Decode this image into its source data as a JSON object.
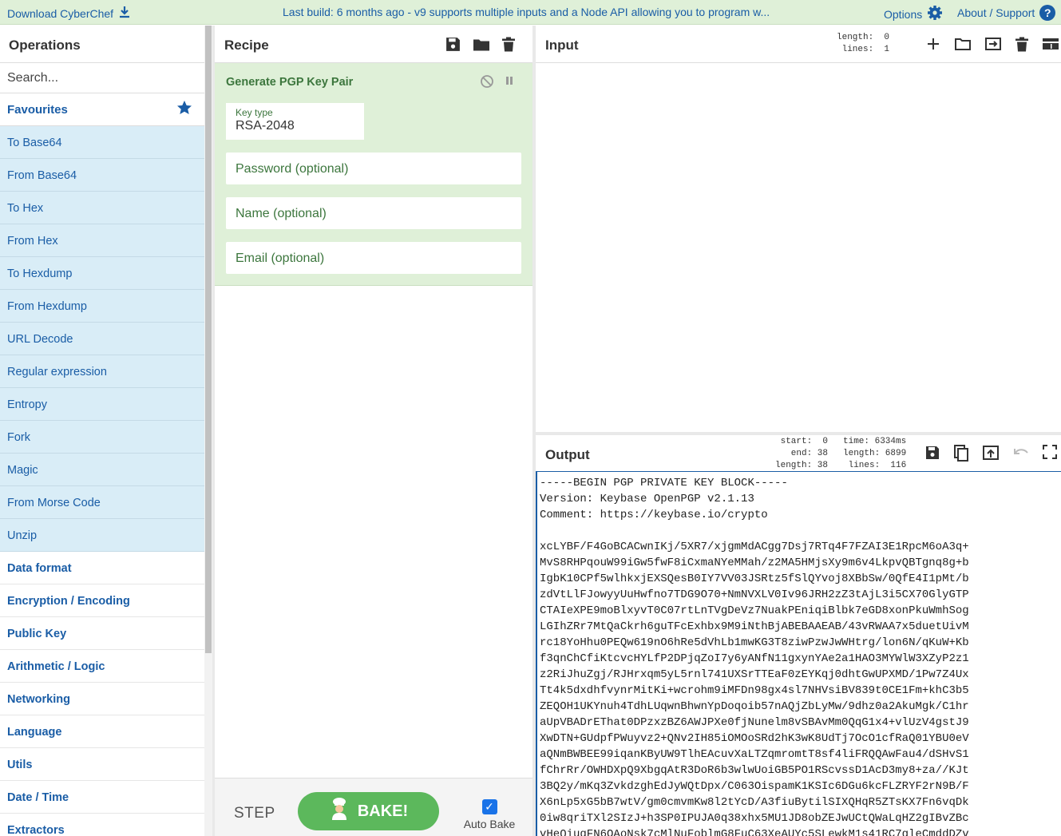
{
  "banner": {
    "download_label": "Download CyberChef",
    "message": "Last build: 6 months ago - v9 supports multiple inputs and a Node API allowing you to program w...",
    "options_label": "Options",
    "about_label": "About / Support",
    "help_glyph": "?"
  },
  "operations": {
    "title": "Operations",
    "search_placeholder": "Search...",
    "favourites_label": "Favourites",
    "favourites": [
      "To Base64",
      "From Base64",
      "To Hex",
      "From Hex",
      "To Hexdump",
      "From Hexdump",
      "URL Decode",
      "Regular expression",
      "Entropy",
      "Fork",
      "Magic",
      "From Morse Code",
      "Unzip"
    ],
    "categories": [
      "Data format",
      "Encryption / Encoding",
      "Public Key",
      "Arithmetic / Logic",
      "Networking",
      "Language",
      "Utils",
      "Date / Time",
      "Extractors"
    ]
  },
  "recipe": {
    "title": "Recipe",
    "operation": {
      "name": "Generate PGP Key Pair",
      "key_type_label": "Key type",
      "key_type_value": "RSA-2048",
      "password_placeholder": "Password (optional)",
      "name_placeholder": "Name (optional)",
      "email_placeholder": "Email (optional)"
    },
    "controls": {
      "step_label": "STEP",
      "bake_label": "BAKE!",
      "auto_bake_label": "Auto Bake",
      "auto_bake_checked": true
    }
  },
  "input": {
    "title": "Input",
    "stats": "length:  0\n lines:  1"
  },
  "output": {
    "title": "Output",
    "sel_stats": "start:  0\n  end: 38\nlength: 38",
    "run_stats": "time: 6334ms\nlength: 6899\n lines:  116",
    "text": "-----BEGIN PGP PRIVATE KEY BLOCK-----\nVersion: Keybase OpenPGP v2.1.13\nComment: https://keybase.io/crypto\n\nxcLYBF/F4GoBCACwnIKj/5XR7/xjgmMdACgg7Dsj7RTq4F7FZAI3E1RpcM6oA3q+\nMvS8RHPqouW99iGw5fwF8iCxmaNYeMMah/z2MA5HMjsXy9m6v4LkpvQBTgnq8g+b\nIgbK10CPf5wlhkxjEXSQesB0IY7VV03JSRtz5fSlQYvoj8XBbSw/0QfE4I1pMt/b\nzdVtLlFJowyyUuHwfno7TDG9O70+NmNVXLV0Iv96JRH2zZ3tAjL3i5CX70GlyGTP\nCTAIeXPE9moBlxyvT0C07rtLnTVgDeVz7NuakPEniqiBlbk7eGD8xonPkuWmhSog\nLGIhZRr7MtQaCkrh6guTFcExhbx9M9iNthBjABEBAAEAB/43vRWAA7x5duetUivM\nrc18YoHhu0PEQw619nO6hRe5dVhLb1mwKG3T8ziwPzwJwWHtrg/lon6N/qKuW+Kb\nf3qnChCfiKtcvcHYLfP2DPjqZoI7y6yANfN11gxynYAe2a1HAO3MYWlW3XZyP2z1\nz2RiJhuZgj/RJHrxqm5yL5rnl741UXSrTTEaF0zEYKqj0dhtGwUPXMD/1Pw7Z4Ux\nTt4k5dxdhfvynrMitKi+wcrohm9iMFDn98gx4sl7NHVsiBV839t0CE1Fm+khC3b5\nZEQOH1UKYnuh4TdhLUqwnBhwnYpDoqoib57nAQjZbLyMw/9dhz0a2AkuMgk/C1hr\naUpVBADrEThat0DPzxzBZ6AWJPXe0fjNunelm8vSBAvMm0QqG1x4+vlUzV4gstJ9\nXwDTN+GUdpfPWuyvz2+QNv2IH85iOMOoSRd2hK3wK8UdTj7OcO1cfRaQ01YBU0eV\naQNmBWBEE99iqanKByUW9TlhEAcuvXaLTZqmromtT8sf4liFRQQAwFau4/dSHvS1\nfChrRr/OWHDXpQ9XbgqAtR3DoR6b3wlwUoiGB5PO1RScvssD1AcD3my8+za//KJt\n3BQ2y/mKq3ZvkdzghEdJyWQtDpx/C063OispamK1KSIc6DGu6kcFLZRYF2rN9B/F\nX6nLp5xG5bB7wtV/gm0cmvmKw8l2tYcD/A3fiuBytilSIXQHqR5ZTsKX7Fn6vqDk\n0iw8qriTXl2SIzJ+h3SP0IPUJA0q38xhx5MU1JD8obZEJwUCtQWaLqHZ2gIBvZBc\nvHeQiugFN6OAoNsk7cMlNuFoblmG8FuC63XeAUYc5SLewkM1s41RC7gleCmddDZv"
  }
}
